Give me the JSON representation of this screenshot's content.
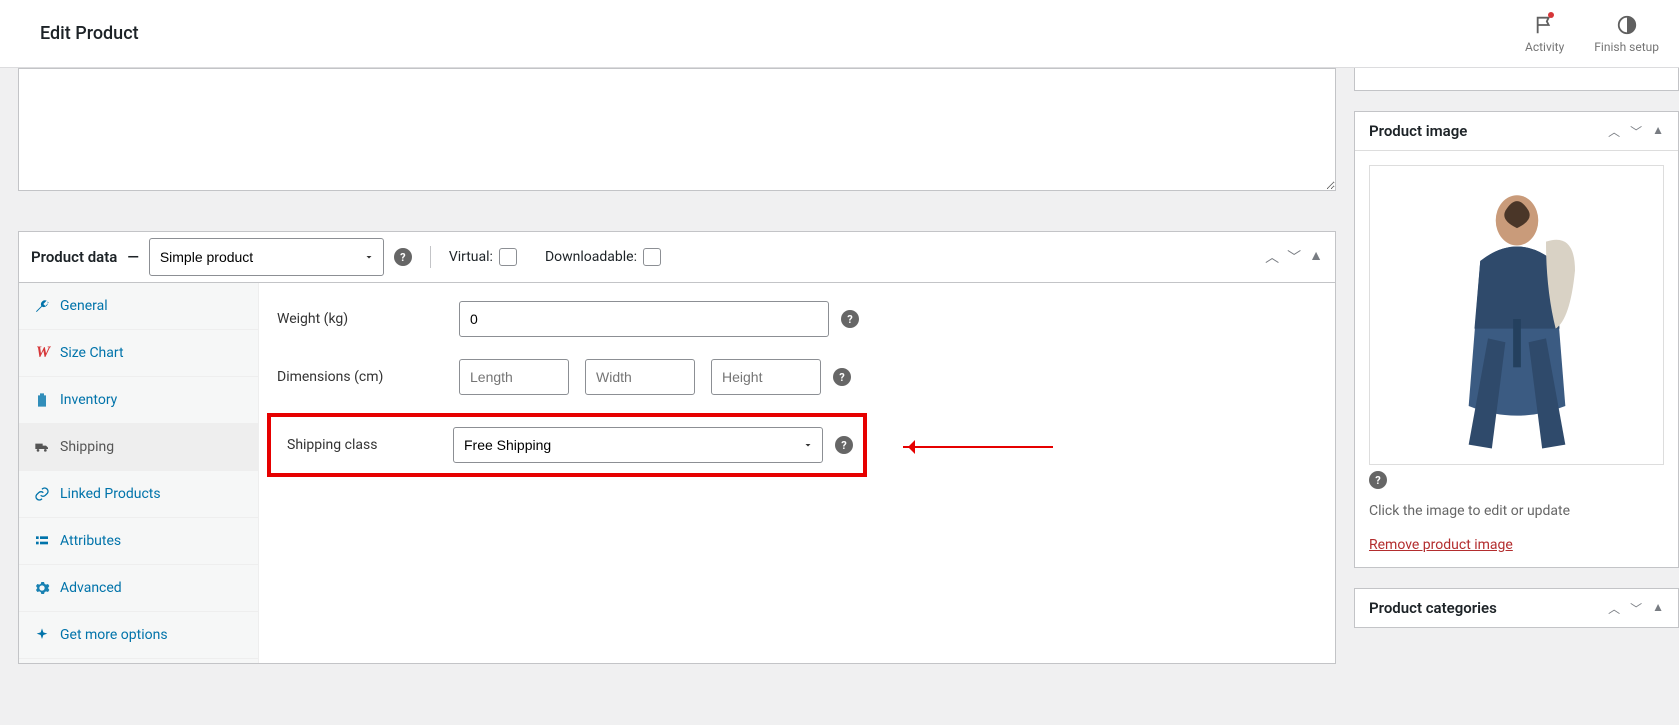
{
  "header": {
    "title": "Edit Product",
    "actions": {
      "activity": "Activity",
      "finish_setup": "Finish setup"
    }
  },
  "product_data": {
    "title": "Product data",
    "type_select": "Simple product",
    "virtual_label": "Virtual:",
    "downloadable_label": "Downloadable:",
    "tabs": [
      {
        "key": "general",
        "label": "General"
      },
      {
        "key": "size_chart",
        "label": "Size Chart"
      },
      {
        "key": "inventory",
        "label": "Inventory"
      },
      {
        "key": "shipping",
        "label": "Shipping"
      },
      {
        "key": "linked",
        "label": "Linked Products"
      },
      {
        "key": "attributes",
        "label": "Attributes"
      },
      {
        "key": "advanced",
        "label": "Advanced"
      },
      {
        "key": "more",
        "label": "Get more options"
      }
    ],
    "shipping": {
      "weight_label": "Weight (kg)",
      "weight_value": "0",
      "dimensions_label": "Dimensions (cm)",
      "length_ph": "Length",
      "width_ph": "Width",
      "height_ph": "Height",
      "class_label": "Shipping class",
      "class_value": "Free Shipping"
    }
  },
  "sidebar": {
    "image_panel_title": "Product image",
    "image_hint": "Click the image to edit or update",
    "remove_image": "Remove product image",
    "categories_title": "Product categories"
  }
}
